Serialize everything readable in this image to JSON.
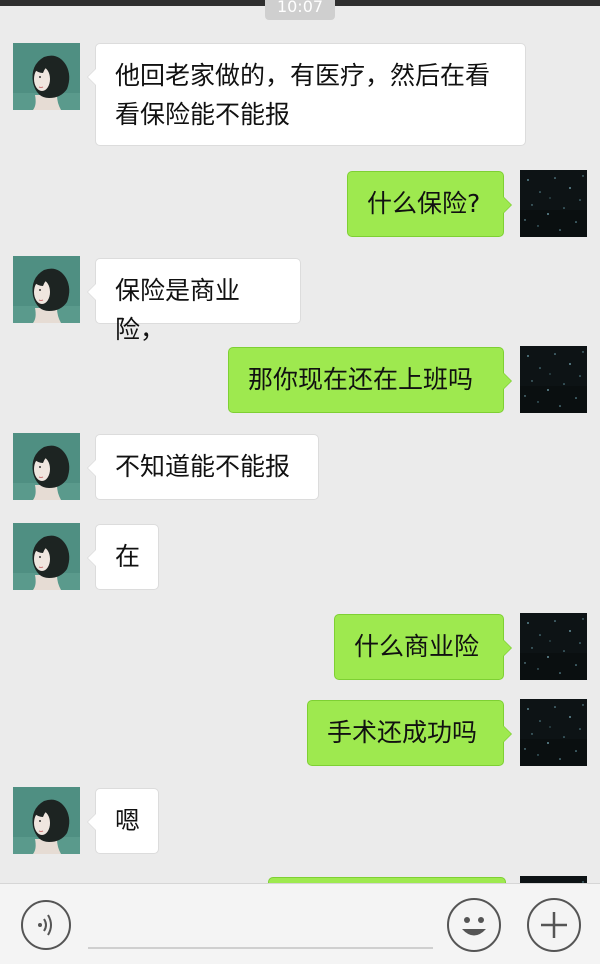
{
  "status": {
    "time": "10:07"
  },
  "colors": {
    "self_bubble": "#9ee94f",
    "other_bubble": "#ffffff",
    "background": "#ebebeb"
  },
  "messages": [
    {
      "side": "left",
      "text": "他回老家做的，有医疗，然后在看看保险能不能报",
      "lines": [
        "他回老家做的，有医疗，然后在看",
        "看保险能不能报"
      ]
    },
    {
      "side": "right",
      "text": "什么保险?"
    },
    {
      "side": "left",
      "text": "保险是商业险，"
    },
    {
      "side": "right",
      "text": "那你现在还在上班吗"
    },
    {
      "side": "left",
      "text": "不知道能不能报"
    },
    {
      "side": "left",
      "text": "在"
    },
    {
      "side": "right",
      "text": "什么商业险"
    },
    {
      "side": "right",
      "text": "手术还成功吗"
    },
    {
      "side": "left",
      "text": "嗯"
    }
  ],
  "input_bar": {
    "voice_icon": "voice-icon",
    "emoji_icon": "emoji-icon",
    "more_icon": "plus-icon"
  }
}
